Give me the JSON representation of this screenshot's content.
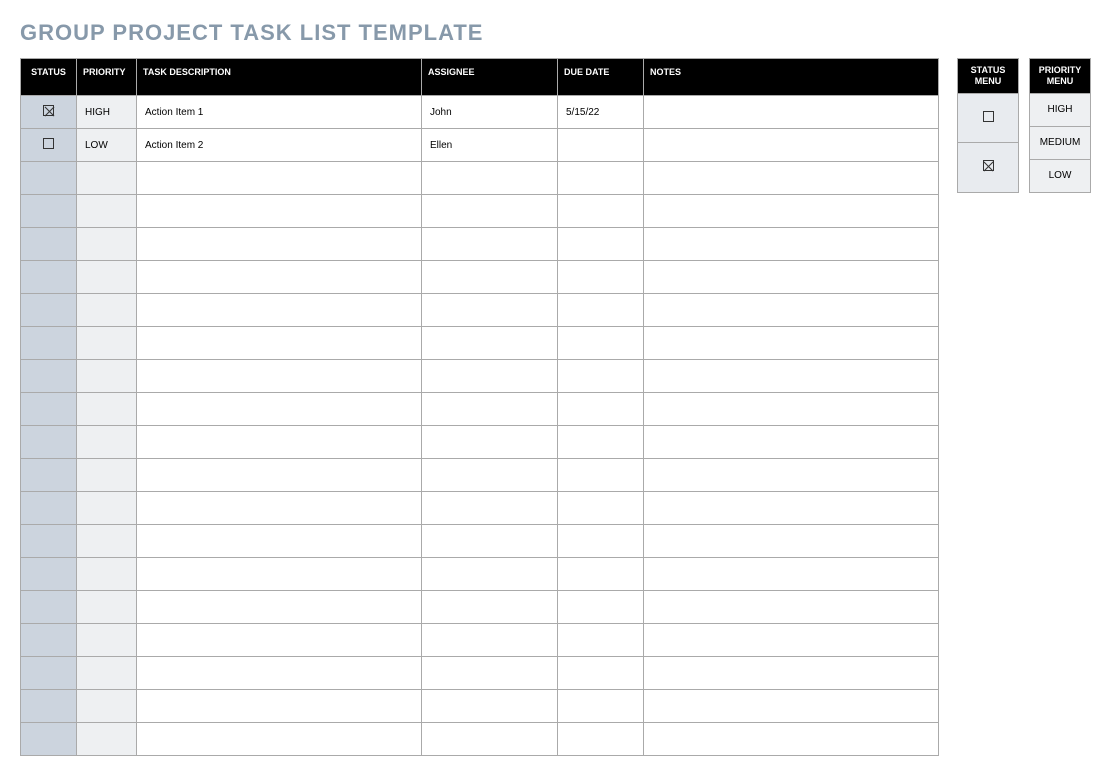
{
  "title": "GROUP PROJECT TASK LIST TEMPLATE",
  "headers": {
    "status": "STATUS",
    "priority": "PRIORITY",
    "desc": "TASK DESCRIPTION",
    "assignee": "ASSIGNEE",
    "due": "DUE DATE",
    "notes": "NOTES"
  },
  "rows": [
    {
      "checked": true,
      "priority": "HIGH",
      "desc": "Action Item 1",
      "assignee": "John",
      "due": "5/15/22",
      "notes": ""
    },
    {
      "checked": false,
      "priority": "LOW",
      "desc": "Action Item 2",
      "assignee": "Ellen",
      "due": "",
      "notes": ""
    },
    {
      "checked": null,
      "priority": "",
      "desc": "",
      "assignee": "",
      "due": "",
      "notes": ""
    },
    {
      "checked": null,
      "priority": "",
      "desc": "",
      "assignee": "",
      "due": "",
      "notes": ""
    },
    {
      "checked": null,
      "priority": "",
      "desc": "",
      "assignee": "",
      "due": "",
      "notes": ""
    },
    {
      "checked": null,
      "priority": "",
      "desc": "",
      "assignee": "",
      "due": "",
      "notes": ""
    },
    {
      "checked": null,
      "priority": "",
      "desc": "",
      "assignee": "",
      "due": "",
      "notes": ""
    },
    {
      "checked": null,
      "priority": "",
      "desc": "",
      "assignee": "",
      "due": "",
      "notes": ""
    },
    {
      "checked": null,
      "priority": "",
      "desc": "",
      "assignee": "",
      "due": "",
      "notes": ""
    },
    {
      "checked": null,
      "priority": "",
      "desc": "",
      "assignee": "",
      "due": "",
      "notes": ""
    },
    {
      "checked": null,
      "priority": "",
      "desc": "",
      "assignee": "",
      "due": "",
      "notes": ""
    },
    {
      "checked": null,
      "priority": "",
      "desc": "",
      "assignee": "",
      "due": "",
      "notes": ""
    },
    {
      "checked": null,
      "priority": "",
      "desc": "",
      "assignee": "",
      "due": "",
      "notes": ""
    },
    {
      "checked": null,
      "priority": "",
      "desc": "",
      "assignee": "",
      "due": "",
      "notes": ""
    },
    {
      "checked": null,
      "priority": "",
      "desc": "",
      "assignee": "",
      "due": "",
      "notes": ""
    },
    {
      "checked": null,
      "priority": "",
      "desc": "",
      "assignee": "",
      "due": "",
      "notes": ""
    },
    {
      "checked": null,
      "priority": "",
      "desc": "",
      "assignee": "",
      "due": "",
      "notes": ""
    },
    {
      "checked": null,
      "priority": "",
      "desc": "",
      "assignee": "",
      "due": "",
      "notes": ""
    },
    {
      "checked": null,
      "priority": "",
      "desc": "",
      "assignee": "",
      "due": "",
      "notes": ""
    },
    {
      "checked": null,
      "priority": "",
      "desc": "",
      "assignee": "",
      "due": "",
      "notes": ""
    }
  ],
  "status_menu": {
    "header": "STATUS MENU",
    "items": [
      {
        "checked": false
      },
      {
        "checked": true
      }
    ]
  },
  "priority_menu": {
    "header": "PRIORITY MENU",
    "items": [
      "HIGH",
      "MEDIUM",
      "LOW"
    ]
  }
}
